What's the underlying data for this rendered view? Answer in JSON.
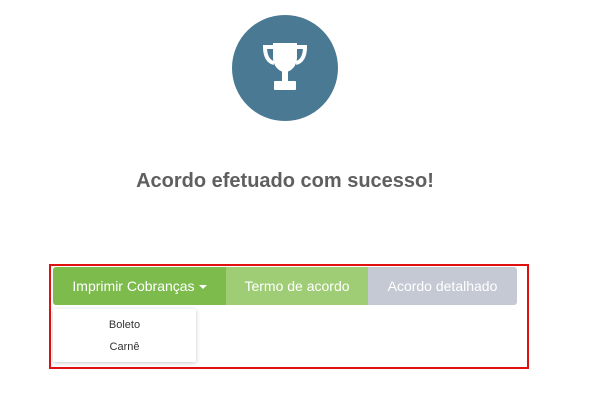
{
  "hero": {
    "icon": "trophy-icon",
    "circle_color": "#4a7a93"
  },
  "message": {
    "text": "Acordo efetuado com sucesso!"
  },
  "actions": {
    "print_label": "Imprimir Cobranças",
    "term_label": "Termo de acordo",
    "detail_label": "Acordo detalhado",
    "print_color": "#7dbb4d",
    "term_color": "#9fcd76",
    "detail_color": "#c4c9d4"
  },
  "dropdown": {
    "items": [
      {
        "label": "Boleto"
      },
      {
        "label": "Carnê"
      }
    ]
  },
  "highlight": {
    "border_color": "#e01010"
  }
}
